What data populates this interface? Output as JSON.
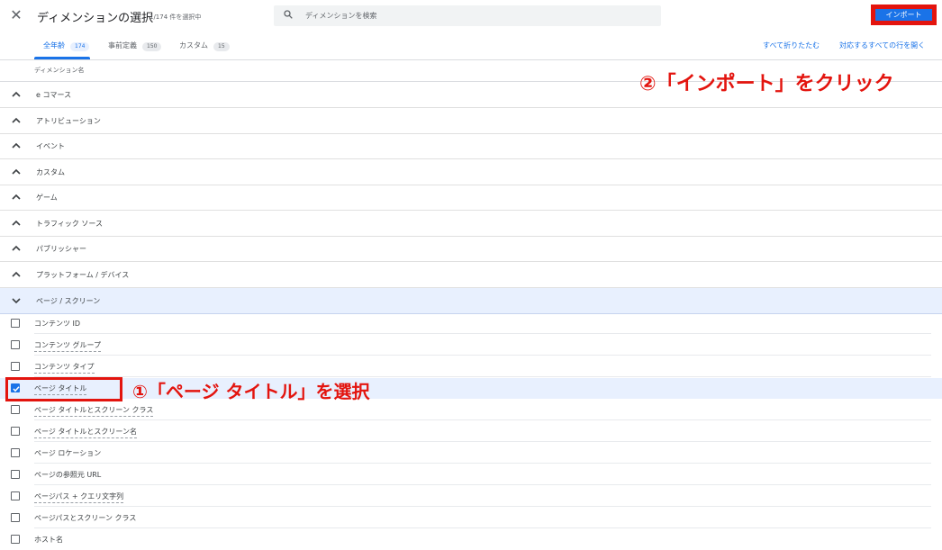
{
  "header": {
    "title": "ディメンションの選択",
    "subtitle": "1/174 件を選択中",
    "search_placeholder": "ディメンションを検索",
    "import_label": "インポート"
  },
  "tabs": [
    {
      "label": "全年齢",
      "count": "174"
    },
    {
      "label": "事前定義",
      "count": "150"
    },
    {
      "label": "カスタム",
      "count": "15"
    }
  ],
  "actions": {
    "collapse_all": "すべて折りたたむ",
    "open_all": "対応するすべての行を開く"
  },
  "column_header": "ディメンション名",
  "categories": [
    "e コマース",
    "アトリビューション",
    "イベント",
    "カスタム",
    "ゲーム",
    "トラフィック ソース",
    "パブリッシャー",
    "プラットフォーム / デバイス",
    "ページ / スクリーン"
  ],
  "items": [
    {
      "label": "コンテンツ ID",
      "checked": false
    },
    {
      "label": "コンテンツ グループ",
      "checked": false
    },
    {
      "label": "コンテンツ タイプ",
      "checked": false
    },
    {
      "label": "ページ タイトル",
      "checked": true
    },
    {
      "label": "ページ タイトルとスクリーン クラス",
      "checked": false
    },
    {
      "label": "ページ タイトルとスクリーン名",
      "checked": false
    },
    {
      "label": "ページ ロケーション",
      "checked": false
    },
    {
      "label": "ページの参照元 URL",
      "checked": false
    },
    {
      "label": "ページパス + クエリ文字列",
      "checked": false
    },
    {
      "label": "ページパスとスクリーン クラス",
      "checked": false
    },
    {
      "label": "ホスト名",
      "checked": false
    }
  ],
  "annotations": {
    "step1": "①「ページ タイトル」を選択",
    "step2": "②「インポート」をクリック"
  },
  "colors": {
    "accent": "#1a73e8",
    "annotation": "#e3140e"
  }
}
